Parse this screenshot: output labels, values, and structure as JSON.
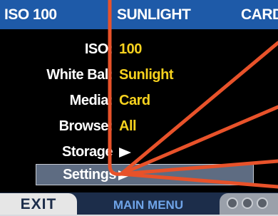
{
  "status": {
    "iso": "ISO 100",
    "white_balance": "SUNLIGHT",
    "media": "CARD"
  },
  "menu": {
    "items": [
      {
        "label": "ISO:",
        "value": "100"
      },
      {
        "label": "White Bal:",
        "value": "Sunlight"
      },
      {
        "label": "Media:",
        "value": "Card"
      },
      {
        "label": "Browse:",
        "value": "All"
      },
      {
        "label": "Storage",
        "value": ""
      },
      {
        "label": "Settings",
        "value": ""
      }
    ],
    "selected_index": 5
  },
  "footer": {
    "exit_label": "EXIT",
    "title": "MAIN MENU"
  },
  "colors": {
    "status_bar": "#1e5aa8",
    "value_text": "#f7d21e",
    "selection": "#5e6c82",
    "annotation_line": "#e8522a"
  },
  "icons": {
    "submenu": "right-triangle-arrow-icon",
    "more": "three-dots-icon"
  }
}
